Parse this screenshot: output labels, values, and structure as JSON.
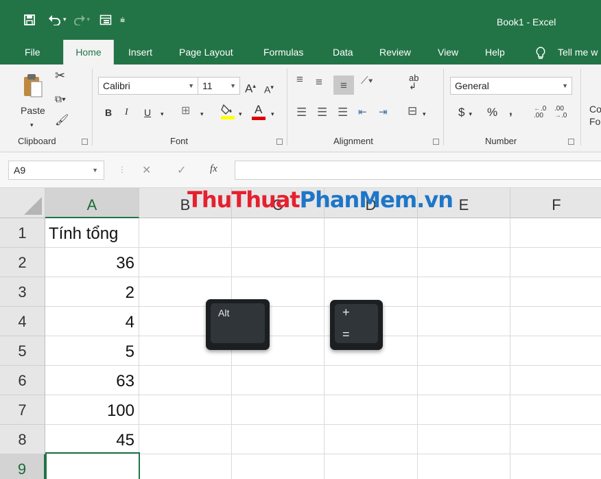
{
  "app": {
    "title": "Book1  -  Excel",
    "accent": "#227446"
  },
  "qat": {
    "icons": [
      "save-icon",
      "undo-icon",
      "redo-icon",
      "form-icon",
      "customize-icon"
    ]
  },
  "tabs": [
    {
      "label": "File"
    },
    {
      "label": "Home"
    },
    {
      "label": "Insert"
    },
    {
      "label": "Page Layout"
    },
    {
      "label": "Formulas"
    },
    {
      "label": "Data"
    },
    {
      "label": "Review"
    },
    {
      "label": "View"
    },
    {
      "label": "Help"
    },
    {
      "label": "Tell me w"
    }
  ],
  "ribbon": {
    "clipboard": {
      "paste": "Paste",
      "label": "Clipboard"
    },
    "font": {
      "name": "Calibri",
      "size": "11",
      "bold": "B",
      "italic": "I",
      "underline": "U",
      "grow": "A",
      "shrink": "A",
      "color": "A",
      "label": "Font"
    },
    "alignment": {
      "label": "Alignment",
      "wrap": "ab"
    },
    "number": {
      "format": "General",
      "currency": "$",
      "percent": "%",
      "comma": ",",
      "inc_decimal": ".0",
      "dec_decimal": ".00",
      "label": "Number"
    },
    "styles": {
      "cond_line1": "Co",
      "cond_line2": "For"
    }
  },
  "formula_bar": {
    "name_box": "A9",
    "fx": "fx",
    "cancel": "✕",
    "enter": "✓",
    "value": ""
  },
  "sheet": {
    "columns": [
      "A",
      "B",
      "C",
      "D",
      "E",
      "F"
    ],
    "rows": [
      "1",
      "2",
      "3",
      "4",
      "5",
      "6",
      "7",
      "8",
      "9"
    ],
    "a1": "Tính tổng",
    "values": [
      "36",
      "2",
      "4",
      "5",
      "63",
      "100",
      "45"
    ],
    "active_cell": "A9"
  },
  "watermark": {
    "red": "ThuThuat",
    "blue": "PhanMem.vn"
  },
  "keys": {
    "alt": "Alt",
    "plus": "+",
    "equals": "="
  }
}
